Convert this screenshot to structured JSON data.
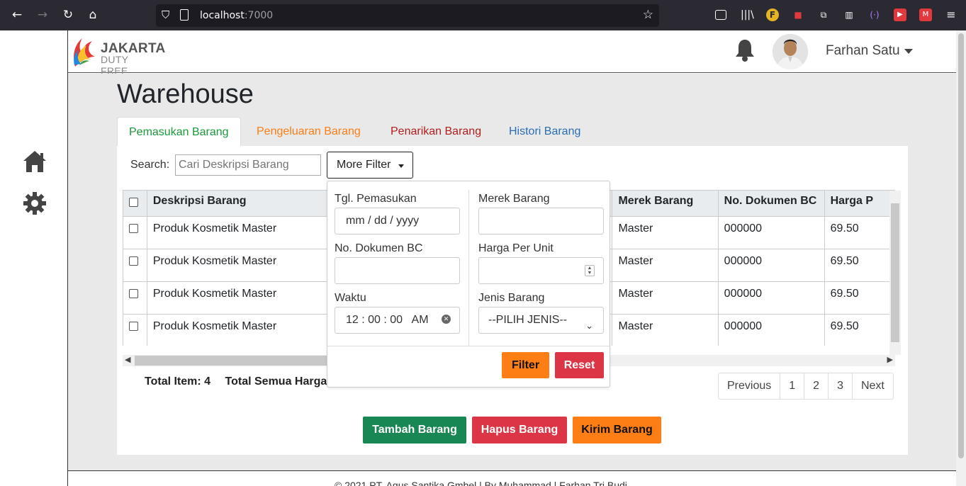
{
  "browser": {
    "url_host": "localhost",
    "url_port": ":7000"
  },
  "app": {
    "logo_line1": "JAKARTA",
    "logo_line2": "DUTY FREE",
    "user_name": "Farhan Satu"
  },
  "page": {
    "title": "Warehouse",
    "tabs": [
      {
        "label": "Pemasukan Barang",
        "color": "#1a9a3a",
        "active": true
      },
      {
        "label": "Pengeluaran Barang",
        "color": "#fd7e14",
        "active": false
      },
      {
        "label": "Penarikan Barang",
        "color": "#b31d1d",
        "active": false
      },
      {
        "label": "Histori Barang",
        "color": "#2a6db5",
        "active": false
      }
    ],
    "search_label": "Search:",
    "search_placeholder": "Cari Deskripsi Barang",
    "more_filter_label": "More Filter"
  },
  "table": {
    "headers": [
      "Deskripsi Barang",
      "Merek Barang",
      "No. Dokumen BC",
      "Harga P"
    ],
    "rows": [
      [
        "Produk Kosmetik Master",
        "Master",
        "000000",
        "69.50"
      ],
      [
        "Produk Kosmetik Master",
        "Master",
        "000000",
        "69.50"
      ],
      [
        "Produk Kosmetik Master",
        "Master",
        "000000",
        "69.50"
      ],
      [
        "Produk Kosmetik Master",
        "Master",
        "000000",
        "69.50"
      ]
    ]
  },
  "summary": {
    "total_item_label": "Total Item:",
    "total_item_value": "4",
    "total_harga_label": "Total Semua Harga"
  },
  "pagination": [
    "Previous",
    "1",
    "2",
    "3",
    "Next"
  ],
  "actions": {
    "add": "Tambah Barang",
    "delete": "Hapus Barang",
    "send": "Kirim Barang"
  },
  "filter": {
    "tgl_label": "Tgl. Pemasukan",
    "tgl_value": "mm / dd / yyyy",
    "dokumen_label": "No. Dokumen BC",
    "waktu_label": "Waktu",
    "waktu_value": "12 : 00 : 00   AM",
    "merek_label": "Merek Barang",
    "harga_label": "Harga Per Unit",
    "jenis_label": "Jenis Barang",
    "jenis_value": "--PILIH JENIS--",
    "filter_btn": "Filter",
    "reset_btn": "Reset"
  },
  "footer": {
    "text": "© 2021 PT. Agus Santika Gmbel | By Muhammad | Farhan Tri Budi"
  },
  "colors": {
    "green": "#198754",
    "red": "#dc3545",
    "orange": "#fd7e14"
  }
}
